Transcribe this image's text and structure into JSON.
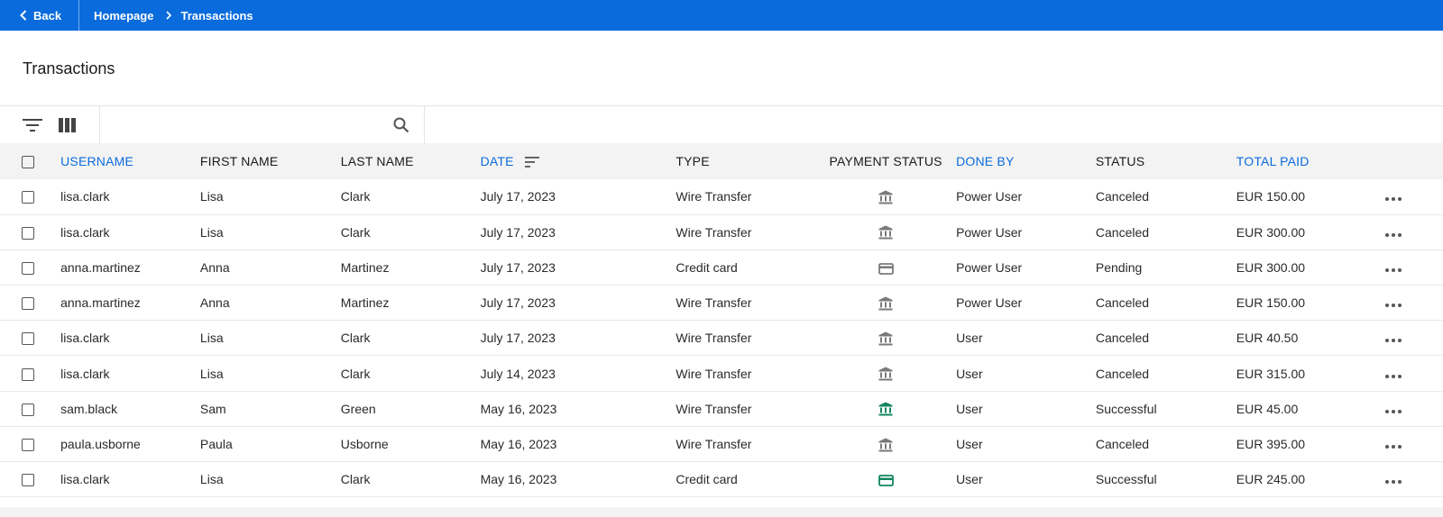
{
  "nav": {
    "back_label": "Back",
    "breadcrumb": [
      "Homepage",
      "Transactions"
    ]
  },
  "page": {
    "title": "Transactions"
  },
  "toolbar": {
    "filter_icon": "filter-icon",
    "columns_icon": "columns-icon",
    "search_placeholder": "",
    "search_value": ""
  },
  "colors": {
    "brand": "#0a6bdc",
    "success_icon": "#11855f",
    "neutral_icon": "#7a7a7a"
  },
  "table": {
    "columns": [
      {
        "label": "USERNAME",
        "sortable": true
      },
      {
        "label": "FIRST NAME",
        "sortable": false
      },
      {
        "label": "LAST NAME",
        "sortable": false
      },
      {
        "label": "DATE",
        "sortable": true,
        "sorted": true
      },
      {
        "label": "TYPE",
        "sortable": false
      },
      {
        "label": "PAYMENT STATUS",
        "sortable": false
      },
      {
        "label": "DONE BY",
        "sortable": true
      },
      {
        "label": "STATUS",
        "sortable": false
      },
      {
        "label": "TOTAL PAID",
        "sortable": true
      }
    ],
    "rows": [
      {
        "username": "lisa.clark",
        "first": "Lisa",
        "last": "Clark",
        "date": "July 17, 2023",
        "type": "Wire Transfer",
        "pay_icon": "bank-icon",
        "pay_ok": false,
        "done_by": "Power User",
        "status": "Canceled",
        "total": "EUR 150.00"
      },
      {
        "username": "lisa.clark",
        "first": "Lisa",
        "last": "Clark",
        "date": "July 17, 2023",
        "type": "Wire Transfer",
        "pay_icon": "bank-icon",
        "pay_ok": false,
        "done_by": "Power User",
        "status": "Canceled",
        "total": "EUR 300.00"
      },
      {
        "username": "anna.martinez",
        "first": "Anna",
        "last": "Martinez",
        "date": "July 17, 2023",
        "type": "Credit card",
        "pay_icon": "credit-card-icon",
        "pay_ok": false,
        "done_by": "Power User",
        "status": "Pending",
        "total": "EUR 300.00"
      },
      {
        "username": "anna.martinez",
        "first": "Anna",
        "last": "Martinez",
        "date": "July 17, 2023",
        "type": "Wire Transfer",
        "pay_icon": "bank-icon",
        "pay_ok": false,
        "done_by": "Power User",
        "status": "Canceled",
        "total": "EUR 150.00"
      },
      {
        "username": "lisa.clark",
        "first": "Lisa",
        "last": "Clark",
        "date": "July 17, 2023",
        "type": "Wire Transfer",
        "pay_icon": "bank-icon",
        "pay_ok": false,
        "done_by": "User",
        "status": "Canceled",
        "total": "EUR 40.50"
      },
      {
        "username": "lisa.clark",
        "first": "Lisa",
        "last": "Clark",
        "date": "July 14, 2023",
        "type": "Wire Transfer",
        "pay_icon": "bank-icon",
        "pay_ok": false,
        "done_by": "User",
        "status": "Canceled",
        "total": "EUR 315.00"
      },
      {
        "username": "sam.black",
        "first": "Sam",
        "last": "Green",
        "date": "May 16, 2023",
        "type": "Wire Transfer",
        "pay_icon": "bank-icon",
        "pay_ok": true,
        "done_by": "User",
        "status": "Successful",
        "total": "EUR 45.00"
      },
      {
        "username": "paula.usborne",
        "first": "Paula",
        "last": "Usborne",
        "date": "May 16, 2023",
        "type": "Wire Transfer",
        "pay_icon": "bank-icon",
        "pay_ok": false,
        "done_by": "User",
        "status": "Canceled",
        "total": "EUR 395.00"
      },
      {
        "username": "lisa.clark",
        "first": "Lisa",
        "last": "Clark",
        "date": "May 16, 2023",
        "type": "Credit card",
        "pay_icon": "credit-card-icon",
        "pay_ok": true,
        "done_by": "User",
        "status": "Successful",
        "total": "EUR 245.00"
      }
    ]
  }
}
